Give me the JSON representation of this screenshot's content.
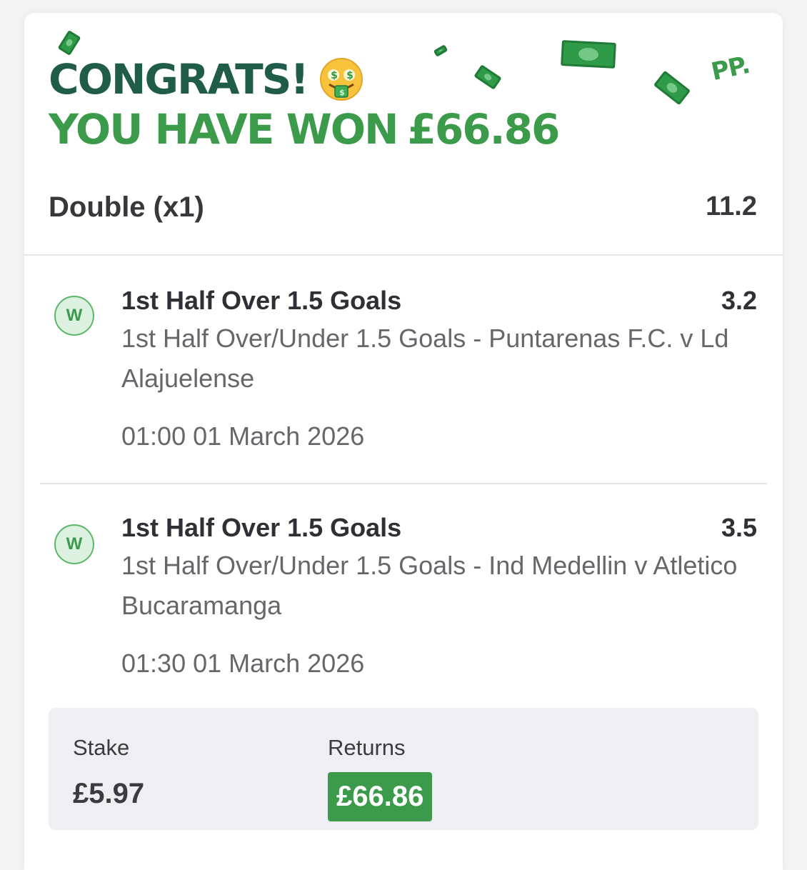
{
  "header": {
    "congrats": "CONGRATS!",
    "won_prefix": "YOU HAVE WON",
    "won_amount": "£66.86",
    "emoji_icon": "money-mouth-face-emoji",
    "logo_text": "PP."
  },
  "bet": {
    "type": "Double (x1)",
    "total_odds": "11.2"
  },
  "selections": [
    {
      "status": "W",
      "market": "1st Half Over 1.5 Goals",
      "odds": "3.2",
      "description": "1st Half Over/Under 1.5 Goals - Puntarenas F.C. v Ld Alajuelense",
      "time": "01:00 01 March 2026"
    },
    {
      "status": "W",
      "market": "1st Half Over 1.5 Goals",
      "odds": "3.5",
      "description": "1st Half Over/Under 1.5 Goals - Ind Medellin v Atletico Bucaramanga",
      "time": "01:30 01 March 2026"
    }
  ],
  "summary": {
    "stake_label": "Stake",
    "stake_value": "£5.97",
    "returns_label": "Returns",
    "returns_value": "£66.86"
  },
  "colors": {
    "brand_dark_green": "#1f5c49",
    "brand_green": "#3c9b4b",
    "badge_bg": "#ddf1e0"
  }
}
